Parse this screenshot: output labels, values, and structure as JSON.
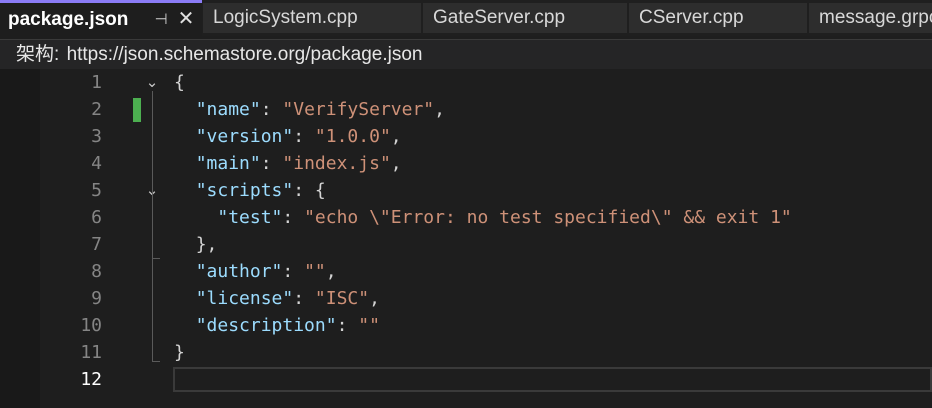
{
  "tabs": [
    {
      "label": "package.json",
      "active": true
    },
    {
      "label": "LogicSystem.cpp",
      "active": false
    },
    {
      "label": "GateServer.cpp",
      "active": false
    },
    {
      "label": "CServer.cpp",
      "active": false
    },
    {
      "label": "message.grpc",
      "active": false
    }
  ],
  "tab_icons": {
    "pin": "pin-icon",
    "close": "close-icon"
  },
  "schema": {
    "label": "架构:",
    "url": "https://json.schemastore.org/package.json"
  },
  "editor": {
    "current_line": 12,
    "line_numbers": [
      "1",
      "2",
      "3",
      "4",
      "5",
      "6",
      "7",
      "8",
      "9",
      "10",
      "11",
      "12"
    ],
    "lines": [
      {
        "indent": "",
        "key": "",
        "sep": "",
        "value": "",
        "tail": "{"
      },
      {
        "indent": "  ",
        "key": "\"name\"",
        "sep": ": ",
        "value": "\"VerifyServer\"",
        "tail": ","
      },
      {
        "indent": "  ",
        "key": "\"version\"",
        "sep": ": ",
        "value": "\"1.0.0\"",
        "tail": ","
      },
      {
        "indent": "  ",
        "key": "\"main\"",
        "sep": ": ",
        "value": "\"index.js\"",
        "tail": ","
      },
      {
        "indent": "  ",
        "key": "\"scripts\"",
        "sep": ": ",
        "value": "",
        "tail": "{"
      },
      {
        "indent": "    ",
        "key": "\"test\"",
        "sep": ": ",
        "value": "\"echo \\\"Error: no test specified\\\" && exit 1\"",
        "tail": ""
      },
      {
        "indent": "  ",
        "key": "",
        "sep": "",
        "value": "",
        "tail": "},"
      },
      {
        "indent": "  ",
        "key": "\"author\"",
        "sep": ": ",
        "value": "\"\"",
        "tail": ","
      },
      {
        "indent": "  ",
        "key": "\"license\"",
        "sep": ": ",
        "value": "\"ISC\"",
        "tail": ","
      },
      {
        "indent": "  ",
        "key": "\"description\"",
        "sep": ": ",
        "value": "\"\"",
        "tail": ""
      },
      {
        "indent": "",
        "key": "",
        "sep": "",
        "value": "",
        "tail": "}"
      },
      {
        "indent": "",
        "key": "",
        "sep": "",
        "value": "",
        "tail": ""
      }
    ],
    "fold_glyph": "⌄",
    "colors": {
      "key": "#9cdcfe",
      "string": "#ce9178",
      "punct": "#d4d4d4",
      "change": "#4caf50",
      "accent": "#8b7cf6"
    }
  }
}
